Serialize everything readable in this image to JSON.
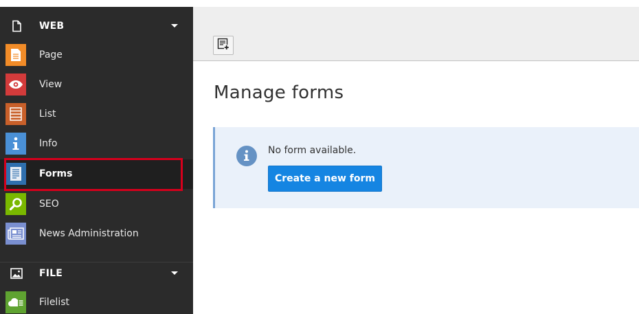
{
  "sidebar": {
    "groups": [
      {
        "label": "WEB",
        "icon": "document-icon",
        "modules": [
          {
            "label": "Page",
            "icon": "page-icon",
            "color": "#f28c28"
          },
          {
            "label": "View",
            "icon": "eye-icon",
            "color": "#d33b3b"
          },
          {
            "label": "List",
            "icon": "list-icon",
            "color": "#c9602a"
          },
          {
            "label": "Info",
            "icon": "info-icon",
            "color": "#4a90d6"
          },
          {
            "label": "Forms",
            "icon": "forms-icon",
            "color": "#2f6fae",
            "active": true
          },
          {
            "label": "SEO",
            "icon": "magnifier-icon",
            "color": "#7ab800"
          },
          {
            "label": "News Administration",
            "icon": "news-icon",
            "color": "#7a8fd0"
          }
        ]
      },
      {
        "label": "FILE",
        "icon": "image-icon",
        "modules": [
          {
            "label": "Filelist",
            "icon": "cloud-icon",
            "color": "#5fa331"
          }
        ]
      }
    ]
  },
  "header": {
    "new_form_button": "new-form-icon"
  },
  "main": {
    "title": "Manage forms",
    "callout": {
      "message": "No form available.",
      "button_label": "Create a new form"
    }
  },
  "colors": {
    "sidebar_bg": "#2b2b2b",
    "highlight": "#d6001c",
    "primary_button": "#1585e2",
    "callout_bg": "#eaf1fa"
  }
}
